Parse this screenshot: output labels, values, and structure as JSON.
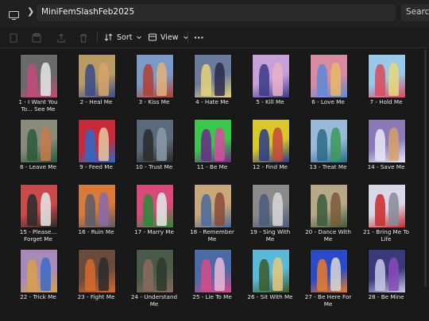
{
  "addressbar": {
    "path": "MiniFemSlashFeb2025",
    "search_label": "Search"
  },
  "toolbar": {
    "sort_label": "Sort",
    "view_label": "View",
    "more_label": "···"
  },
  "files": [
    {
      "name": "1 - I Want You To... See Me",
      "colors": [
        "#6a6a6a",
        "#c44a7a",
        "#e8e8e8"
      ]
    },
    {
      "name": "2 - Heal Me",
      "colors": [
        "#b79b63",
        "#3a4a8a",
        "#d6a56a"
      ]
    },
    {
      "name": "3 - Kiss Me",
      "colors": [
        "#7a9ac8",
        "#b04030",
        "#e2b27c"
      ]
    },
    {
      "name": "4 - Hate Me",
      "colors": [
        "#6a7a9a",
        "#e8d27a",
        "#2a2a4a"
      ]
    },
    {
      "name": "5 - Kill Me",
      "colors": [
        "#c8a0d8",
        "#3a3a8a",
        "#e8b0c8"
      ]
    },
    {
      "name": "6 - Love Me",
      "colors": [
        "#d88aa0",
        "#5a8ad8",
        "#e8b86a"
      ]
    },
    {
      "name": "7 - Hold Me",
      "colors": [
        "#9ac8e8",
        "#d84a5a",
        "#e8d87a"
      ]
    },
    {
      "name": "8 - Leave Me",
      "colors": [
        "#8a8a7a",
        "#2a5a3a",
        "#c87a4a"
      ]
    },
    {
      "name": "9 - Feed Me",
      "colors": [
        "#c82a3a",
        "#2a6ac8",
        "#e8c8a0"
      ]
    },
    {
      "name": "10 - Trust Me",
      "colors": [
        "#5a6a7a",
        "#2a2a2a",
        "#8a9aaa"
      ]
    },
    {
      "name": "11 - Be Me",
      "colors": [
        "#3ac84a",
        "#6a2a8a",
        "#d84aa0"
      ]
    },
    {
      "name": "12 - Find Me",
      "colors": [
        "#d8c82a",
        "#2a3a8a",
        "#c84a3a"
      ]
    },
    {
      "name": "13 - Treat Me",
      "colors": [
        "#9ab8d8",
        "#2a6a8a",
        "#3a9a5a"
      ]
    },
    {
      "name": "14 - Save Me",
      "colors": [
        "#8a7ab8",
        "#e8e8f8",
        "#d8a06a"
      ]
    },
    {
      "name": "15 - Please... Forget Me",
      "colors": [
        "#c84a4a",
        "#2a2a2a",
        "#e8e8e8"
      ]
    },
    {
      "name": "16 - Ruin Me",
      "colors": [
        "#d87a3a",
        "#5a5a6a",
        "#8a6aa8"
      ]
    },
    {
      "name": "17 - Marry Me",
      "colors": [
        "#d84a7a",
        "#2a8a3a",
        "#e8e8e8"
      ]
    },
    {
      "name": "18 - Remember Me",
      "colors": [
        "#c8a87a",
        "#4a6a9a",
        "#8a4a3a"
      ]
    },
    {
      "name": "19 - Sing With Me",
      "colors": [
        "#8a8a8a",
        "#4a5a7a",
        "#d8d8d8"
      ]
    },
    {
      "name": "20 - Dance With Me",
      "colors": [
        "#b8a88a",
        "#3a5a3a",
        "#7a5a3a"
      ]
    },
    {
      "name": "21 - Bring Me To Life",
      "colors": [
        "#d8d8e8",
        "#c82a2a",
        "#8a8a9a"
      ]
    },
    {
      "name": "22 - Trick Me",
      "colors": [
        "#a88ab8",
        "#d8a04a",
        "#3a6ac8"
      ]
    },
    {
      "name": "23 - Fight Me",
      "colors": [
        "#6a4a3a",
        "#d86a2a",
        "#2a2a2a"
      ]
    },
    {
      "name": "24 - Understand Me",
      "colors": [
        "#4a5a4a",
        "#8a6a5a",
        "#2a3a2a"
      ]
    },
    {
      "name": "25 - Lie To Me",
      "colors": [
        "#4a6aa8",
        "#d84a8a",
        "#e8b8d8"
      ]
    },
    {
      "name": "26 - Sit With Me",
      "colors": [
        "#5ab8d8",
        "#3a5a2a",
        "#e8c87a"
      ]
    },
    {
      "name": "27 - Be Here For Me",
      "colors": [
        "#2a4ac8",
        "#e87a2a",
        "#d8d8d8"
      ]
    },
    {
      "name": "28 - Be Mine",
      "colors": [
        "#3a3a7a",
        "#c8c8e8",
        "#8a4ab8"
      ]
    }
  ]
}
